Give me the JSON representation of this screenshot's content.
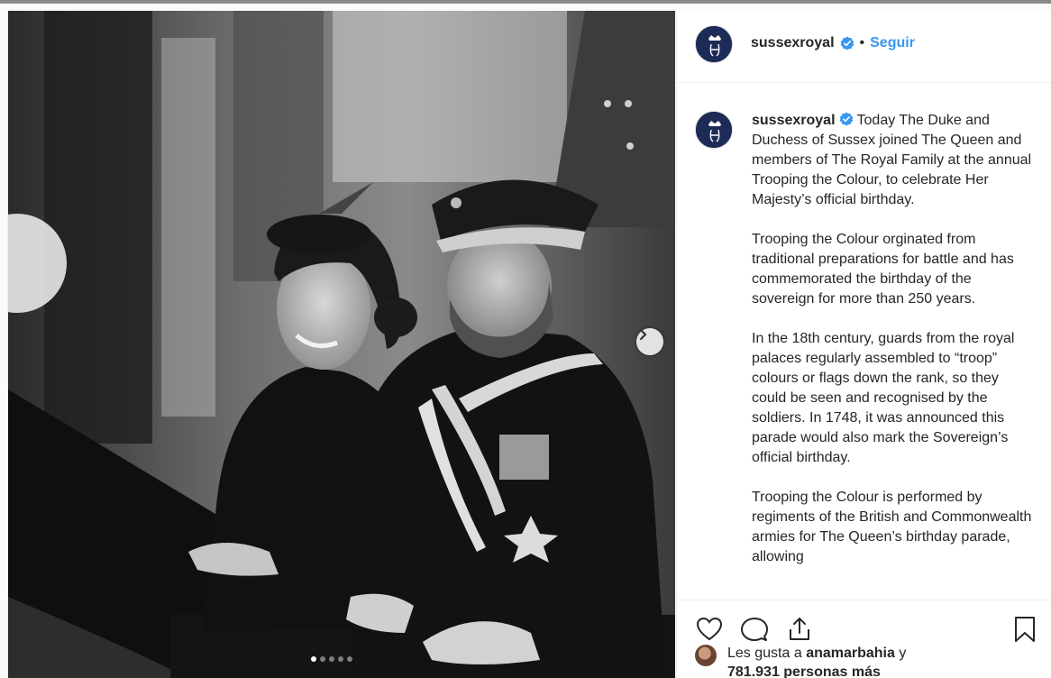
{
  "post": {
    "photo_alt": "",
    "carousel": {
      "count": 5,
      "active_index": 0
    }
  },
  "header": {
    "username": "sussexroyal",
    "separator": "•",
    "follow_label": "Seguir"
  },
  "caption": {
    "username": "sussexroyal",
    "paragraphs": [
      "Today The Duke and Duchess of Sussex joined The Queen and members of The Royal Family at the annual Trooping the Colour, to celebrate Her Majesty’s official birthday.",
      "Trooping the Colour orginated from traditional preparations for battle and has commemorated the birthday of the sovereign for more than 250 years.",
      "In the 18th century, guards from the royal palaces regularly assembled to “troop” colours or flags down the rank, so they could be seen and recognised by the soldiers. In 1748, it was announced this parade would also mark the Sovereign’s official birthday.",
      "Trooping the Colour is performed by regiments of the British and Commonwealth armies for The Queen’s birthday parade, allowing"
    ]
  },
  "likes": {
    "prefix": "Les gusta a",
    "first_user": "anamarbahia",
    "conjunction": "y",
    "others": "781.931 personas más"
  },
  "icons": {
    "like": "heart-icon",
    "comment": "comment-icon",
    "share": "share-icon",
    "save": "bookmark-icon",
    "next": "chevron-right-icon",
    "verified": "verified-badge-icon"
  },
  "colors": {
    "link_blue": "#3897f0",
    "verified_blue": "#3897f0",
    "avatar_navy": "#1d2b57"
  }
}
